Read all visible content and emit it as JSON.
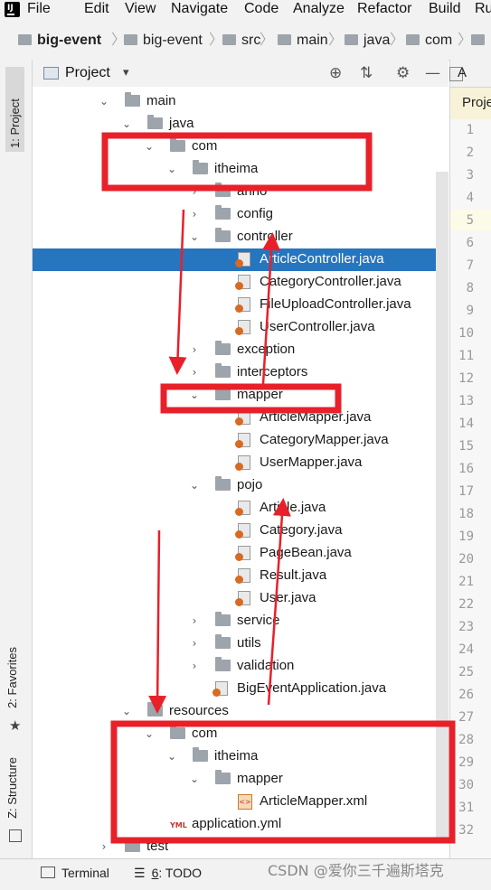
{
  "menu": [
    "File",
    "Edit",
    "View",
    "Navigate",
    "Code",
    "Analyze",
    "Refactor",
    "Build",
    "Ru"
  ],
  "app_logo_text": "IJ",
  "breadcrumb": [
    "big-event",
    "big-event",
    "src",
    "main",
    "java",
    "com"
  ],
  "tool_windows": {
    "project": "1: Project",
    "favorites": "2: Favorites",
    "structure": "Z: Structure"
  },
  "project_panel": {
    "title": "Project",
    "caret": "▾",
    "btn_locate": "⊕",
    "btn_collapse": "⇅",
    "btn_settings": "⚙",
    "btn_hide": "—"
  },
  "tree": [
    {
      "label": "main",
      "type": "folder",
      "arrow": "⌄"
    },
    {
      "label": "java",
      "type": "folder",
      "arrow": "⌄"
    },
    {
      "label": "com",
      "type": "folder",
      "arrow": "⌄"
    },
    {
      "label": "itheima",
      "type": "folder",
      "arrow": "⌄"
    },
    {
      "label": "anno",
      "type": "folder",
      "arrow": "›"
    },
    {
      "label": "config",
      "type": "folder",
      "arrow": "›"
    },
    {
      "label": "controller",
      "type": "folder",
      "arrow": "⌄"
    },
    {
      "label": "ArticleController.java",
      "type": "java",
      "selected": true
    },
    {
      "label": "CategoryController.java",
      "type": "java"
    },
    {
      "label": "FileUploadController.java",
      "type": "java"
    },
    {
      "label": "UserController.java",
      "type": "java"
    },
    {
      "label": "exception",
      "type": "folder",
      "arrow": "›"
    },
    {
      "label": "interceptors",
      "type": "folder",
      "arrow": "›"
    },
    {
      "label": "mapper",
      "type": "folder",
      "arrow": "⌄"
    },
    {
      "label": "ArticleMapper.java",
      "type": "java"
    },
    {
      "label": "CategoryMapper.java",
      "type": "java"
    },
    {
      "label": "UserMapper.java",
      "type": "java"
    },
    {
      "label": "pojo",
      "type": "folder",
      "arrow": "⌄"
    },
    {
      "label": "Article.java",
      "type": "java"
    },
    {
      "label": "Category.java",
      "type": "java"
    },
    {
      "label": "PageBean.java",
      "type": "java"
    },
    {
      "label": "Result.java",
      "type": "java"
    },
    {
      "label": "User.java",
      "type": "java"
    },
    {
      "label": "service",
      "type": "folder",
      "arrow": "›"
    },
    {
      "label": "utils",
      "type": "folder",
      "arrow": "›"
    },
    {
      "label": "validation",
      "type": "folder",
      "arrow": "›"
    },
    {
      "label": "BigEventApplication.java",
      "type": "java"
    },
    {
      "label": "resources",
      "type": "folder",
      "arrow": "⌄"
    },
    {
      "label": "com",
      "type": "folder",
      "arrow": "⌄"
    },
    {
      "label": "itheima",
      "type": "folder",
      "arrow": "⌄"
    },
    {
      "label": "mapper",
      "type": "folder",
      "arrow": "⌄"
    },
    {
      "label": "ArticleMapper.xml",
      "type": "xml"
    },
    {
      "label": "application.yml",
      "type": "yml"
    },
    {
      "label": "test",
      "type": "folder",
      "arrow": "›"
    }
  ],
  "editor": {
    "tab_label": "A",
    "hint": "Proje",
    "line_numbers": [
      "1",
      "2",
      "3",
      "4",
      "5",
      "6",
      "7",
      "8",
      "9",
      "10",
      "11",
      "12",
      "13",
      "14",
      "15",
      "16",
      "17",
      "18",
      "19",
      "20",
      "21",
      "22",
      "23",
      "24",
      "25",
      "26",
      "27",
      "28",
      "29",
      "30",
      "31",
      "32"
    ]
  },
  "bottom": {
    "terminal": "Terminal",
    "todo_num": "6",
    "todo_text": ": TODO",
    "watermark": "CSDN @爱你三千遍斯塔克"
  },
  "colors": {
    "selection": "#2675bf",
    "annotation_red": "#e8202a",
    "folder": "#9da4ab",
    "java_badge": "#d86a22"
  },
  "icons": {
    "folder": "folder-icon",
    "java": "java-class-icon",
    "xml": "xml-file-icon",
    "yml": "yaml-file-icon",
    "terminal": "terminal-icon",
    "todo": "todo-list-icon",
    "star": "star-icon",
    "structure": "structure-icon"
  }
}
